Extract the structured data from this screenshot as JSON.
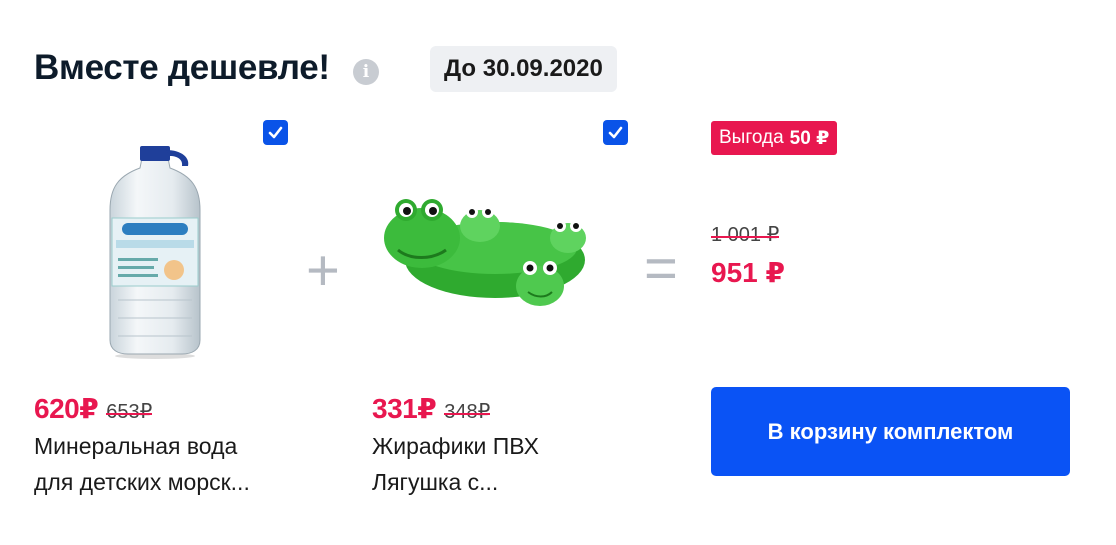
{
  "header": {
    "title": "Вместе дешевле!",
    "info_icon": "info-icon",
    "date_badge": "До 30.09.2020"
  },
  "products": [
    {
      "image": "water-bottle-image",
      "checked": true,
      "price": "620₽",
      "old_price": "653₽",
      "name_line1": "Минеральная вода",
      "name_line2": "для детских морск..."
    },
    {
      "image": "frog-toys-image",
      "checked": true,
      "price": "331₽",
      "old_price": "348₽",
      "name_line1": "Жирафики ПВХ",
      "name_line2": "Лягушка с..."
    }
  ],
  "operators": {
    "plus": "+",
    "equals": "="
  },
  "summary": {
    "benefit_label": "Выгода",
    "benefit_value": "50 ₽",
    "old_total": "1 001 ₽",
    "new_total": "951 ₽"
  },
  "cart_button": "В корзину комплектом",
  "colors": {
    "accent_red": "#e8174f",
    "brand_blue": "#0a53f5",
    "badge_gray": "#eef0f3"
  }
}
